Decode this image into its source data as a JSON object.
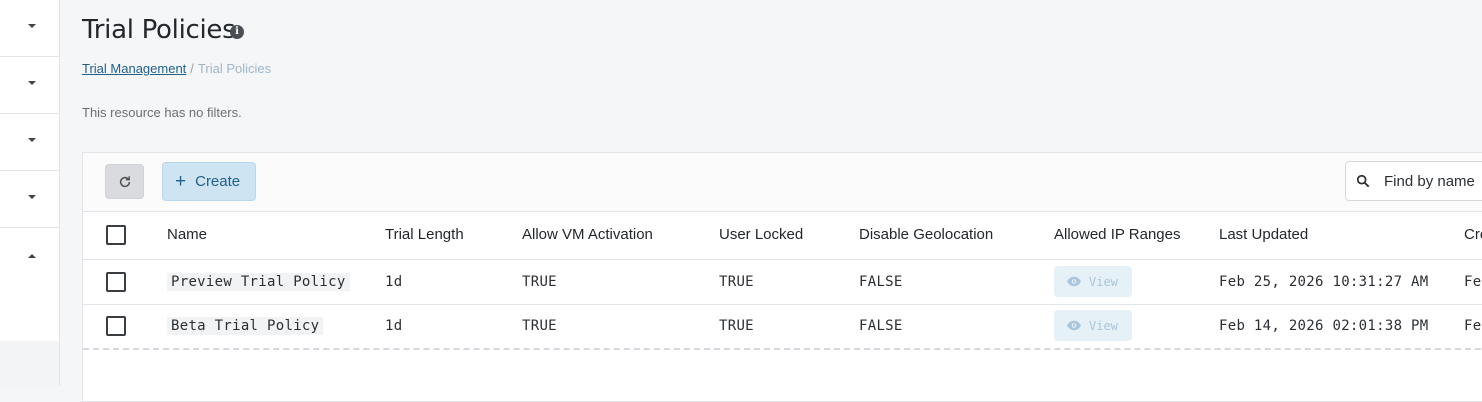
{
  "header": {
    "title": "Trial Policies",
    "info_icon": "info-icon"
  },
  "breadcrumb": {
    "parent": "Trial Management",
    "separator": "/",
    "current": "Trial Policies"
  },
  "filters_note": "This resource has no filters.",
  "toolbar": {
    "refresh_icon": "refresh-icon",
    "create_label": "Create",
    "create_icon": "plus-icon",
    "search_placeholder": "Find by name",
    "search_icon": "search-icon"
  },
  "table": {
    "columns": [
      "Name",
      "Trial Length",
      "Allow VM Activation",
      "User Locked",
      "Disable Geolocation",
      "Allowed IP Ranges",
      "Last Updated",
      "Cre"
    ],
    "rows": [
      {
        "name": "Preview Trial Policy",
        "trial_length": "1d",
        "allow_vm": "TRUE",
        "user_locked": "TRUE",
        "disable_geo": "FALSE",
        "ip_ranges": "View",
        "last_updated": "Feb 25, 2026 10:31:27 AM",
        "created": "Fe"
      },
      {
        "name": "Beta Trial Policy",
        "trial_length": "1d",
        "allow_vm": "TRUE",
        "user_locked": "TRUE",
        "disable_geo": "FALSE",
        "ip_ranges": "View",
        "last_updated": "Feb 14, 2026 02:01:38 PM",
        "created": "Fe"
      }
    ]
  },
  "colors": {
    "accent": "#1f5f8b",
    "create_bg": "#cfe4f3",
    "background": "#f5f6f7"
  }
}
